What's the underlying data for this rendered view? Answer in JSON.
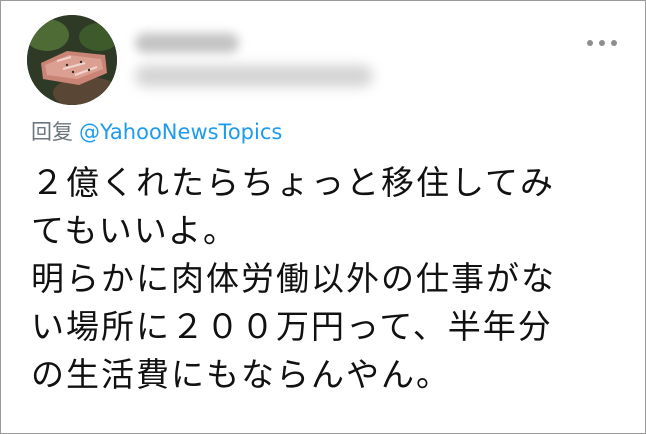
{
  "reply": {
    "prefix": "回复",
    "handle": "@YahooNewsTopics"
  },
  "tweet": {
    "lines": [
      "２億くれたらちょっと移住してみ",
      "てもいいよ。",
      "明らかに肉体労働以外の仕事がな",
      "い場所に２００万円って、半年分",
      "の生活費にもならんやん。"
    ]
  },
  "icons": {
    "avatar": "avatar-grilled-meat-photo",
    "more": "more-options-icon"
  },
  "colors": {
    "text": "#111111",
    "muted": "#6e767d",
    "link": "#1d9bf0"
  }
}
